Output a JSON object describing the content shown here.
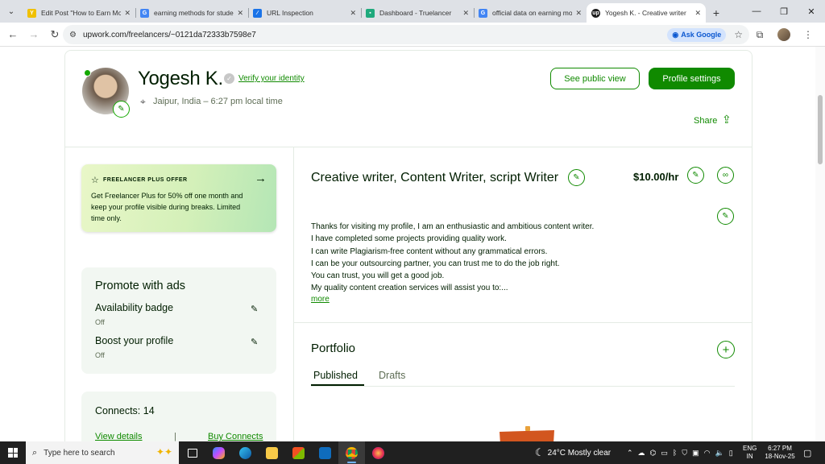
{
  "browser": {
    "tabs": [
      {
        "title": "Edit Post \"How to Earn Mo",
        "favicon": "wordpress-favicon",
        "color": "#f0c000",
        "active": false
      },
      {
        "title": "earning methods for stude",
        "favicon": "google-favicon",
        "color": "#4285f4",
        "active": false
      },
      {
        "title": "URL Inspection",
        "favicon": "search-console-favicon",
        "color": "#1a73e8",
        "active": false
      },
      {
        "title": "Dashboard - Truelancer",
        "favicon": "truelancer-favicon",
        "color": "#1ea97c",
        "active": false
      },
      {
        "title": "official data on earning mo",
        "favicon": "google-favicon",
        "color": "#4285f4",
        "active": false
      },
      {
        "title": "Yogesh K. - Creative writer",
        "favicon": "upwork-favicon",
        "color": "#1d1d1d",
        "active": true
      }
    ],
    "url": "upwork.com/freelancers/~0121da72333b7598e7",
    "ask_google": "Ask Google"
  },
  "profile": {
    "name": "Yogesh K.",
    "verify_label": "Verify your identity",
    "location": "Jaipur, India – 6:27 pm local time",
    "see_public_view": "See public view",
    "profile_settings": "Profile settings",
    "share": "Share"
  },
  "offer": {
    "title": "FREELANCER PLUS OFFER",
    "text": "Get Freelancer Plus for 50% off one month and keep your profile visible during breaks. Limited time only."
  },
  "promote": {
    "title": "Promote with ads",
    "items": [
      {
        "label": "Availability badge",
        "status": "Off"
      },
      {
        "label": "Boost your profile",
        "status": "Off"
      }
    ]
  },
  "connects": {
    "title": "Connects: 14",
    "view_details": "View details",
    "separator": "|",
    "buy": "Buy Connects"
  },
  "main": {
    "job_title": "Creative writer, Content Writer, script Writer",
    "rate": "$10.00/hr",
    "overview": [
      "Thanks for visiting my profile, I am an enthusiastic and ambitious content writer.",
      "I have completed some projects providing quality work.",
      "I can write Plagiarism-free content without any grammatical errors.",
      "I can be your outsourcing partner, you can trust me to do the job right.",
      "You can trust, you will get a good job.",
      "My quality content creation services will assist you to:..."
    ],
    "more": "more",
    "portfolio_title": "Portfolio",
    "tab_published": "Published",
    "tab_drafts": "Drafts"
  },
  "taskbar": {
    "search_placeholder": "Type here to search",
    "weather": "24°C  Mostly clear",
    "lang_line1": "ENG",
    "lang_line2": "IN",
    "time": "6:27 PM",
    "date": "18-Nov-25"
  },
  "colors": {
    "accent": "#108a00",
    "text": "#001e00"
  }
}
